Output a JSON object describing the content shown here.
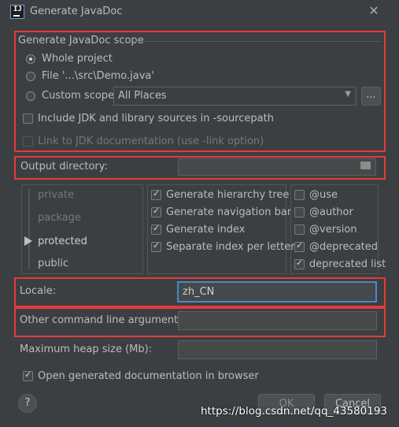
{
  "window": {
    "title": "Generate JavaDoc",
    "app_icon_text": "IJ"
  },
  "scope": {
    "heading": "Generate JavaDoc scope",
    "options": [
      {
        "label": "Whole project",
        "selected": true
      },
      {
        "label": "File '...\\src\\Demo.java'",
        "selected": false
      },
      {
        "label": "Custom scope",
        "selected": false
      }
    ],
    "custom_scope_value": "All Places",
    "browse_label": "...",
    "include_jdk": {
      "label": "Include JDK and library sources in -sourcepath",
      "checked": false
    },
    "link_jdk": {
      "label": "Link to JDK documentation (use -link option)",
      "checked": false
    }
  },
  "output_directory": {
    "label": "Output directory:",
    "value": ""
  },
  "visibility": {
    "levels": [
      "private",
      "package",
      "protected",
      "public"
    ],
    "selected": "protected"
  },
  "generate_options": [
    {
      "label": "Generate hierarchy tree",
      "checked": true
    },
    {
      "label": "Generate navigation bar",
      "checked": true
    },
    {
      "label": "Generate index",
      "checked": true
    },
    {
      "label": "Separate index per letter",
      "checked": true
    }
  ],
  "tag_options": [
    {
      "label": "@use",
      "checked": false
    },
    {
      "label": "@author",
      "checked": false
    },
    {
      "label": "@version",
      "checked": false
    },
    {
      "label": "@deprecated",
      "checked": true
    },
    {
      "label": "deprecated list",
      "checked": true
    }
  ],
  "locale": {
    "label": "Locale:",
    "value": "zh_CN"
  },
  "other_args": {
    "label": "Other command line arguments:",
    "value": ""
  },
  "max_heap": {
    "label": "Maximum heap size (Mb):",
    "value": ""
  },
  "open_in_browser": {
    "label": "Open generated documentation in browser",
    "checked": true
  },
  "buttons": {
    "help": "?",
    "ok": "OK",
    "cancel": "Cancel"
  },
  "watermark": "https://blog.csdn.net/qq_43580193",
  "colors": {
    "highlight_border": "#e53a3a",
    "focus_border": "#4a88c7",
    "background": "#3c3f41"
  }
}
